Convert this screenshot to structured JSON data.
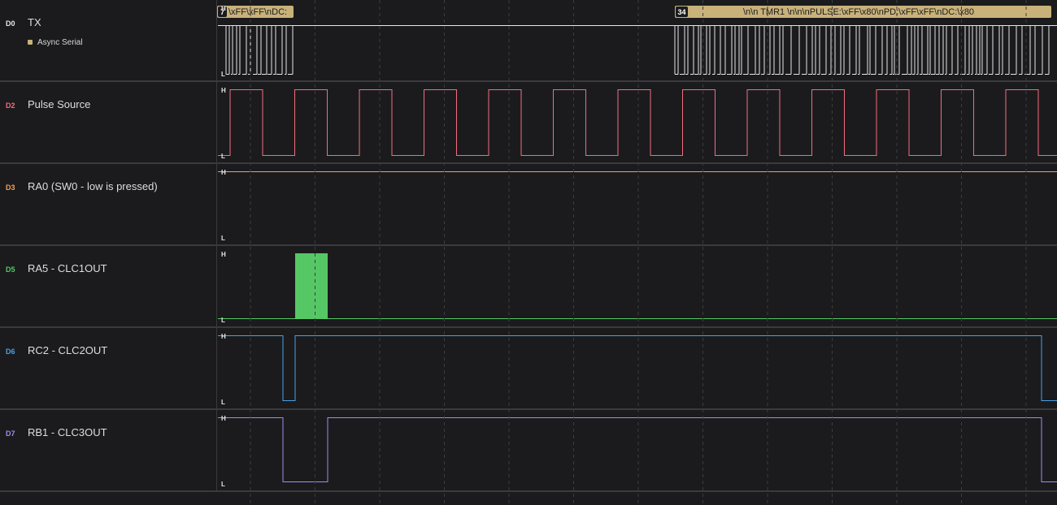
{
  "level_labels": {
    "high": "H",
    "low": "L"
  },
  "analyzer": {
    "name": "Async Serial",
    "color": "#c9b27a"
  },
  "channels": [
    {
      "id": "D0",
      "name": "TX",
      "color": "#e6e6e6",
      "has_analyzer": true
    },
    {
      "id": "D2",
      "name": "Pulse Source",
      "color": "#f06e7e"
    },
    {
      "id": "D3",
      "name": "RA0 (SW0 - low is pressed)",
      "color": "#f0a05a"
    },
    {
      "id": "D5",
      "name": "RA5 - CLC1OUT",
      "color": "#55c865"
    },
    {
      "id": "D6",
      "name": "RC2 - CLC2OUT",
      "color": "#4aa0e6"
    },
    {
      "id": "D7",
      "name": "RB1 - CLC3OUT",
      "color": "#9b8ef0"
    }
  ],
  "protocol_bubbles": [
    {
      "index": "7",
      "text": "\\xFF\\xFF\\nDC:"
    },
    {
      "index": "34",
      "text": "\\n\\n TMR1 \\n\\n\\nPULSE:\\xFF\\x80\\nPD:\\xFF\\xFF\\nDC:\\x80"
    }
  ]
}
